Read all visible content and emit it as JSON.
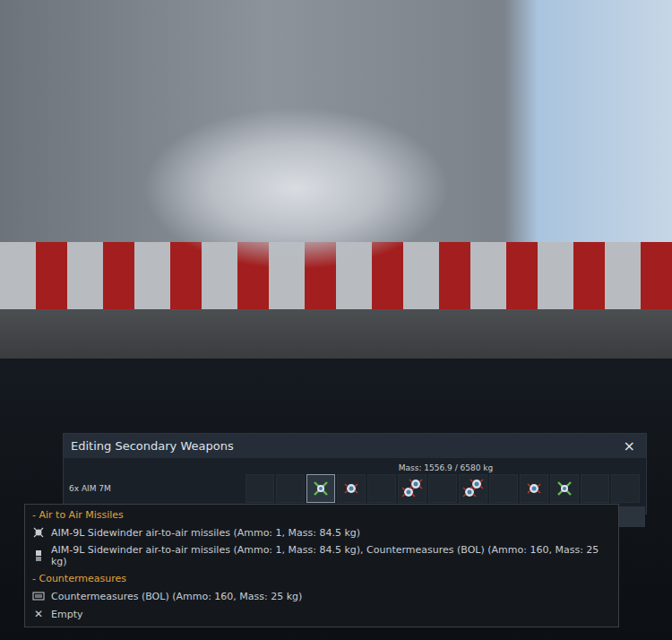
{
  "panel": {
    "title": "Editing Secondary Weapons",
    "close": "×",
    "mass": "Mass: 1556.9 / 6580 kg",
    "row_label": "6x AIM 7M",
    "slots": [
      {
        "kind": "empty",
        "selected": false
      },
      {
        "kind": "empty",
        "selected": false
      },
      {
        "kind": "cross",
        "selected": true
      },
      {
        "kind": "missile",
        "selected": false
      },
      {
        "kind": "empty",
        "selected": false
      },
      {
        "kind": "double",
        "selected": false
      },
      {
        "kind": "empty",
        "selected": false
      },
      {
        "kind": "double",
        "selected": false
      },
      {
        "kind": "empty",
        "selected": false
      },
      {
        "kind": "missile",
        "selected": false
      },
      {
        "kind": "cross",
        "selected": false
      },
      {
        "kind": "empty",
        "selected": false
      },
      {
        "kind": "empty",
        "selected": false
      }
    ]
  },
  "menu": {
    "groups": [
      {
        "header": "- Air to Air Missiles",
        "items": [
          {
            "kind": "missile",
            "text": "AIM-9L Sidewinder air-to-air missiles (Ammo: 1, Mass: 84.5 kg)"
          },
          {
            "kind": "missile-cm",
            "text": "AIM-9L Sidewinder air-to-air missiles (Ammo: 1, Mass: 84.5 kg), Countermeasures (BOL) (Ammo: 160, Mass: 25 kg)"
          }
        ]
      },
      {
        "header": "- Countermeasures",
        "items": [
          {
            "kind": "countermeasure",
            "text": "Countermeasures (BOL) (Ammo: 160, Mass: 25 kg)"
          }
        ]
      }
    ],
    "empty": {
      "icon": "✕",
      "label": "Empty"
    }
  }
}
